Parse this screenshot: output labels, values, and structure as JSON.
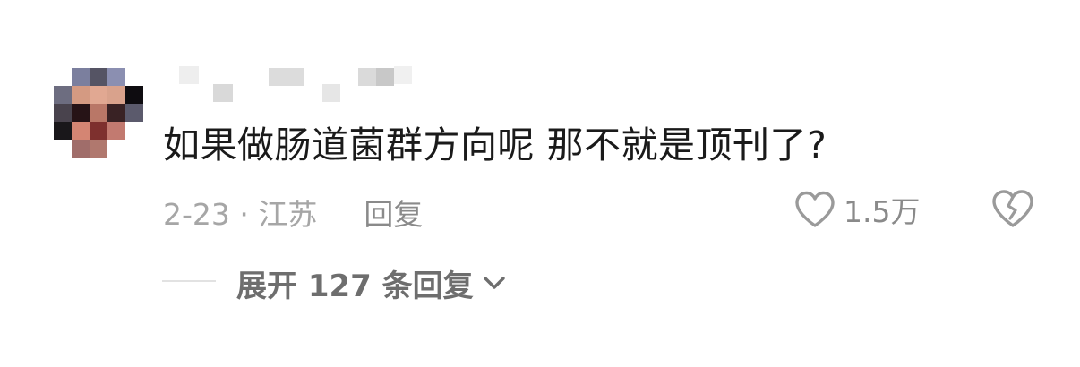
{
  "comment": {
    "text": "如果做肠道菌群方向呢 那不就是顶刊了?",
    "date_location": "2-23 · 江苏",
    "reply_label": "回复",
    "like_count": "1.5万",
    "expand_label": "展开 127 条回复"
  },
  "icons": {
    "like": "heart-outline-icon",
    "dislike": "broken-heart-icon",
    "expand": "chevron-down-icon"
  },
  "colors": {
    "text_primary": "#1a1a1a",
    "text_secondary": "#8a8a8a",
    "text_meta": "#a6a6a6",
    "icon": "#9a9a9a"
  }
}
